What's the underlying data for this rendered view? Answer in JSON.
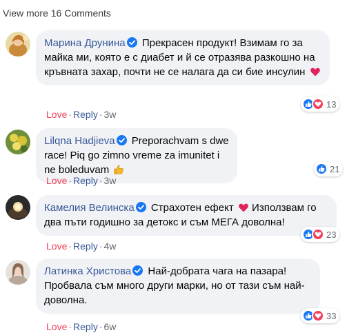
{
  "view_more": "View more 16 Comments",
  "comments": [
    {
      "author": "Марина Друнина",
      "text": "Прекрасен продукт! Взимам го за майка ми, която е с диабет и й се отразява разкошно на кръвната захар, почти не се налага да си бие инсулин",
      "emoji": "heart",
      "love": "Love",
      "reply": "Reply",
      "sep": "·",
      "time": "3w",
      "reactions": [
        "like",
        "love"
      ],
      "count": "13"
    },
    {
      "author": "Lilqna Hadjieva",
      "text": "Preporachvam s dwe race! Piq go zimno vreme za imunitet i ne boleduvam",
      "emoji": "thumbs-up",
      "love": "Love",
      "reply": "Reply",
      "sep": "·",
      "time": "3w",
      "reactions": [
        "like"
      ],
      "count": "21"
    },
    {
      "author": "Камелия Велинска",
      "text_before": "Страхотен ефект",
      "emoji": "heart",
      "text": "Използвам го два пъти годишно за детокс и съм МЕГА доволна!",
      "love": "Love",
      "reply": "Reply",
      "sep": "·",
      "time": "4w",
      "reactions": [
        "like",
        "love"
      ],
      "count": "23"
    },
    {
      "author": "Латинка Христова",
      "text": "Най-добрата чага на пазара! Пробвала съм много други марки, но от тази съм най-доволна.",
      "love": "Love",
      "reply": "Reply",
      "sep": "·",
      "time": "6w",
      "reactions": [
        "like",
        "love"
      ],
      "count": "33"
    }
  ],
  "colors": {
    "author": "#385898",
    "love": "#f33e58",
    "reply": "#385898",
    "bubble": "#f0f2f5",
    "like_blue": "#1877f2",
    "love_red": "#f33e58"
  }
}
